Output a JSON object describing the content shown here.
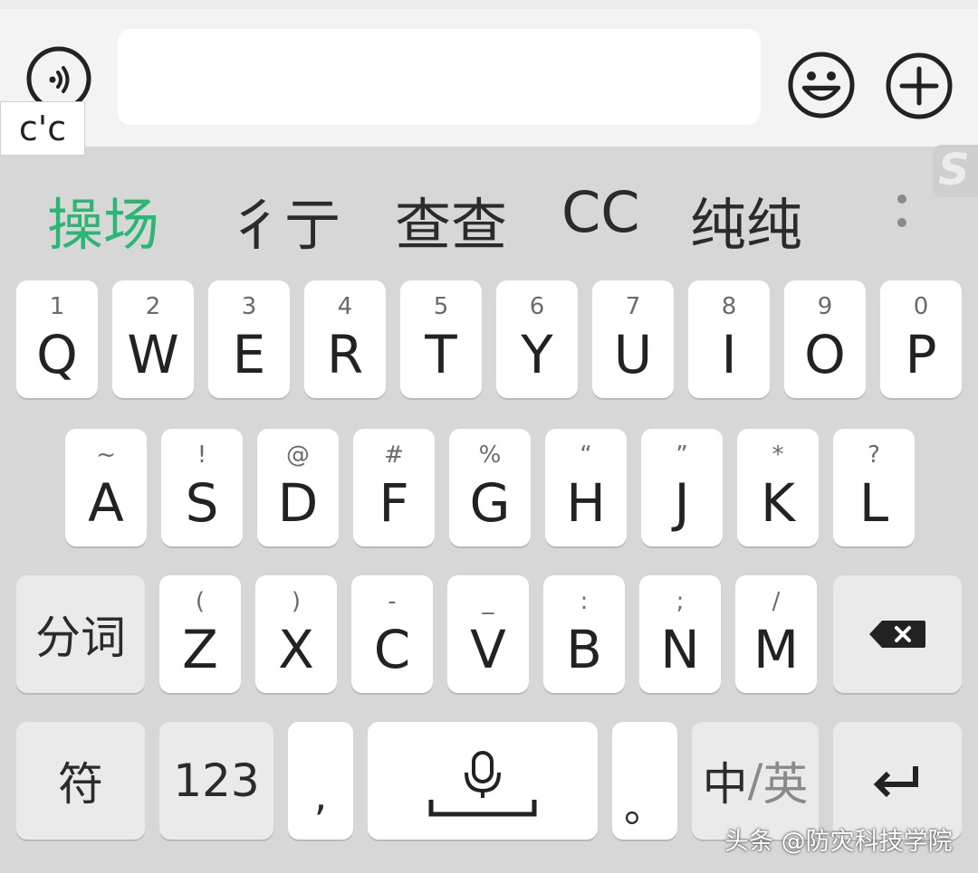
{
  "input_bar": {
    "composing_text": "c'c",
    "text_value": "",
    "voice_icon": "voice-input-icon",
    "emoji_icon": "emoji-icon",
    "plus_icon": "plus-icon"
  },
  "candidates": [
    "操场",
    "彳亍",
    "查查",
    "CC",
    "纯纯"
  ],
  "more_icon": "more-vertical-icon",
  "keyboard": {
    "row1": [
      {
        "hint": "1",
        "main": "Q"
      },
      {
        "hint": "2",
        "main": "W"
      },
      {
        "hint": "3",
        "main": "E"
      },
      {
        "hint": "4",
        "main": "R"
      },
      {
        "hint": "5",
        "main": "T"
      },
      {
        "hint": "6",
        "main": "Y"
      },
      {
        "hint": "7",
        "main": "U"
      },
      {
        "hint": "8",
        "main": "I"
      },
      {
        "hint": "9",
        "main": "O"
      },
      {
        "hint": "0",
        "main": "P"
      }
    ],
    "row2": [
      {
        "hint": "~",
        "main": "A"
      },
      {
        "hint": "!",
        "main": "S"
      },
      {
        "hint": "@",
        "main": "D"
      },
      {
        "hint": "#",
        "main": "F"
      },
      {
        "hint": "%",
        "main": "G"
      },
      {
        "hint": "“",
        "main": "H"
      },
      {
        "hint": "”",
        "main": "J"
      },
      {
        "hint": "*",
        "main": "K"
      },
      {
        "hint": "?",
        "main": "L"
      }
    ],
    "row3": [
      {
        "hint": "(",
        "main": "Z"
      },
      {
        "hint": ")",
        "main": "X"
      },
      {
        "hint": "-",
        "main": "C"
      },
      {
        "hint": "_",
        "main": "V"
      },
      {
        "hint": ":",
        "main": "B"
      },
      {
        "hint": ";",
        "main": "N"
      },
      {
        "hint": "/",
        "main": "M"
      }
    ],
    "split_label": "分词",
    "symbol_label": "符",
    "num_label": "123",
    "comma_label": ",",
    "period_label": "。",
    "lang_cn": "中",
    "lang_sep": "/",
    "lang_en": "英",
    "space_icon": "microphone-icon",
    "backspace_icon": "backspace-icon",
    "enter_icon": "enter-icon"
  },
  "watermark": "头条 @防灾科技学院",
  "watermark_logo": "S"
}
